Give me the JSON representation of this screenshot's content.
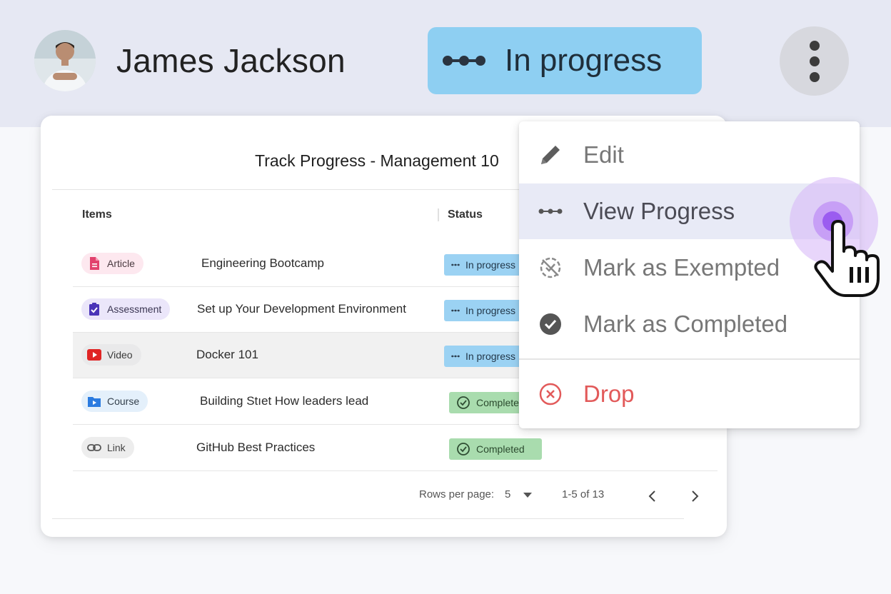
{
  "header": {
    "user_name": "James Jackson",
    "status_label": "In progress",
    "colors": {
      "header_bg": "#e6e8f3",
      "status_chip": "#8ecff2"
    }
  },
  "card": {
    "title": "Track Progress - Management 10",
    "columns": {
      "items": "Items",
      "status": "Status"
    },
    "rows": [
      {
        "type": "Article",
        "type_icon": "document-icon",
        "title": "Engineering Bootcamp",
        "status": "In progress",
        "status_kind": "progress"
      },
      {
        "type": "Assessment",
        "type_icon": "clipboard-check-icon",
        "title": "Set up Your Development Environment",
        "status": "In progress",
        "status_kind": "progress"
      },
      {
        "type": "Video",
        "type_icon": "play-icon",
        "title": "Docker 101",
        "status": "In progress",
        "status_kind": "progress"
      },
      {
        "type": "Course",
        "type_icon": "course-folder-icon",
        "title": "Building Stıet How leaders lead",
        "status": "Completed",
        "status_kind": "completed"
      },
      {
        "type": "Link",
        "type_icon": "link-icon",
        "title": "GitHub Best Practices",
        "status": "Completed",
        "status_kind": "completed"
      }
    ],
    "footer": {
      "rows_per_page_label": "Rows per page:",
      "rows_per_page_value": "5",
      "range": "1-5 of 13"
    }
  },
  "menu": {
    "items": [
      {
        "label": "Edit",
        "icon": "pencil-icon"
      },
      {
        "label": "View Progress",
        "icon": "dots-icon"
      },
      {
        "label": "Mark as Exempted",
        "icon": "exempt-icon"
      },
      {
        "label": "Mark as Completed",
        "icon": "check-circle-icon"
      },
      {
        "label": "Drop",
        "icon": "cancel-circle-icon"
      }
    ],
    "colors": {
      "active_bg": "#e8eaf6",
      "drop": "#e25a5a"
    }
  }
}
